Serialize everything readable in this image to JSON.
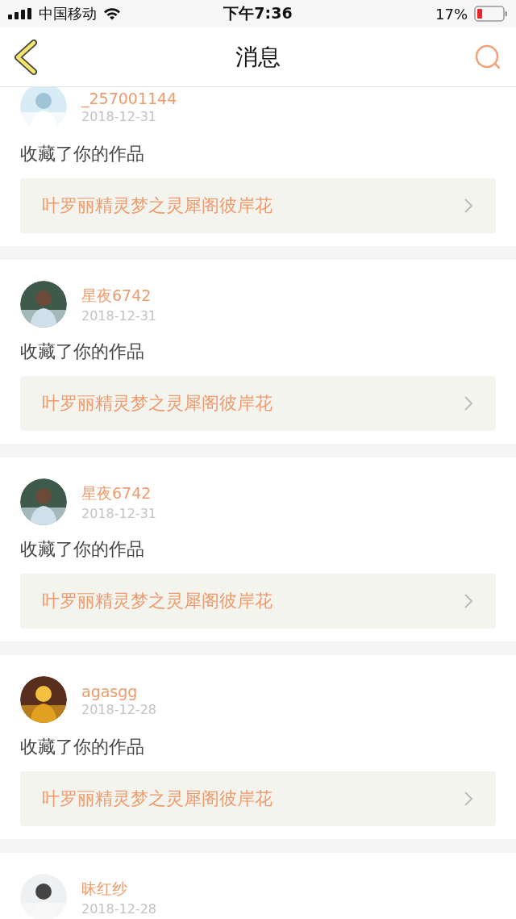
{
  "status_bar": {
    "carrier": "中国移动",
    "time": "下午7:36",
    "battery": "17%"
  },
  "nav": {
    "title": "消息"
  },
  "messages": [
    {
      "name": "_257001144",
      "date": "2018-12-31",
      "action": "收藏了你的作品",
      "work": "叶罗丽精灵梦之灵犀阁彼岸花"
    },
    {
      "name": "星夜6742",
      "date": "2018-12-31",
      "action": "收藏了你的作品",
      "work": "叶罗丽精灵梦之灵犀阁彼岸花"
    },
    {
      "name": "星夜6742",
      "date": "2018-12-31",
      "action": "收藏了你的作品",
      "work": "叶罗丽精灵梦之灵犀阁彼岸花"
    },
    {
      "name": "agasgg",
      "date": "2018-12-28",
      "action": "收藏了你的作品",
      "work": "叶罗丽精灵梦之灵犀阁彼岸花"
    },
    {
      "name": "昧红纱",
      "date": "2018-12-28"
    }
  ]
}
